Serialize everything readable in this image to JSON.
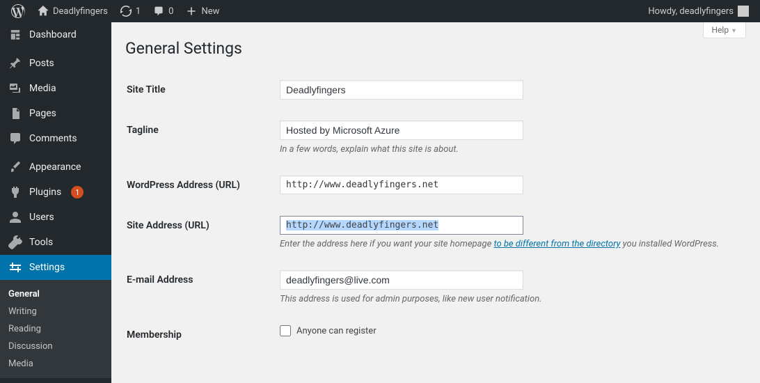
{
  "toolbar": {
    "site_name": "Deadlyfingers",
    "updates_count": "1",
    "comments_count": "0",
    "new_label": "New",
    "greeting": "Howdy, deadlyfingers"
  },
  "sidebar": {
    "dashboard": "Dashboard",
    "posts": "Posts",
    "media": "Media",
    "pages": "Pages",
    "comments": "Comments",
    "appearance": "Appearance",
    "plugins": "Plugins",
    "plugins_badge": "1",
    "users": "Users",
    "tools": "Tools",
    "settings": "Settings",
    "submenu": {
      "general": "General",
      "writing": "Writing",
      "reading": "Reading",
      "discussion": "Discussion",
      "media": "Media"
    }
  },
  "main": {
    "help": "Help",
    "heading": "General Settings",
    "fields": {
      "site_title": {
        "label": "Site Title",
        "value": "Deadlyfingers"
      },
      "tagline": {
        "label": "Tagline",
        "value": "Hosted by Microsoft Azure",
        "desc": "In a few words, explain what this site is about."
      },
      "wp_url": {
        "label": "WordPress Address (URL)",
        "value": "http://www.deadlyfingers.net"
      },
      "site_url": {
        "label": "Site Address (URL)",
        "value": "http://www.deadlyfingers.net",
        "desc_pre": "Enter the address here if you want your site homepage ",
        "desc_link": "to be different from the directory",
        "desc_post": " you installed WordPress."
      },
      "email": {
        "label": "E-mail Address",
        "value": "deadlyfingers@live.com",
        "desc": "This address is used for admin purposes, like new user notification."
      },
      "membership": {
        "label": "Membership",
        "checkbox_label": "Anyone can register"
      }
    }
  }
}
